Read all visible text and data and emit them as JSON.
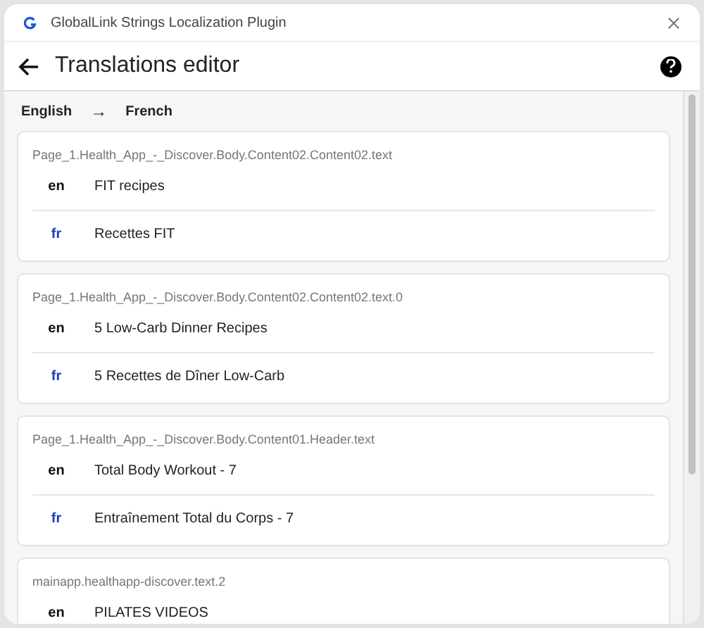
{
  "window": {
    "title": "GlobalLink Strings Localization Plugin"
  },
  "header": {
    "title": "Translations editor"
  },
  "languages": {
    "source": "English",
    "arrow": "→",
    "target": "French"
  },
  "entries": [
    {
      "key": "Page_1.Health_App_-_Discover.Body.Content02.Content02.text",
      "rows": [
        {
          "kind": "source",
          "lang": "en",
          "text": "FIT recipes"
        },
        {
          "kind": "target",
          "lang": "fr",
          "text": "Recettes FIT"
        }
      ]
    },
    {
      "key": "Page_1.Health_App_-_Discover.Body.Content02.Content02.text.0",
      "rows": [
        {
          "kind": "source",
          "lang": "en",
          "text": "5 Low-Carb Dinner Recipes"
        },
        {
          "kind": "target",
          "lang": "fr",
          "text": "5 Recettes de Dîner Low-Carb"
        }
      ]
    },
    {
      "key": "Page_1.Health_App_-_Discover.Body.Content01.Header.text",
      "rows": [
        {
          "kind": "source",
          "lang": "en",
          "text": "Total Body Workout - 7"
        },
        {
          "kind": "target",
          "lang": "fr",
          "text": "Entraînement Total du Corps - 7"
        }
      ]
    },
    {
      "key": "mainapp.healthapp-discover.text.2",
      "rows": [
        {
          "kind": "source",
          "lang": "en",
          "text": "PILATES VIDEOS"
        }
      ]
    }
  ]
}
